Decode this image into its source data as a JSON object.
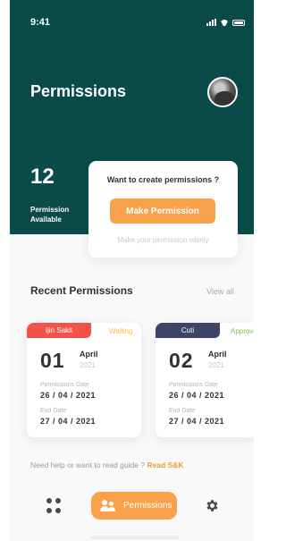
{
  "status_bar": {
    "time": "9:41"
  },
  "header": {
    "title": "Permissions",
    "available_count": "12",
    "available_label": "Permission Available"
  },
  "create_card": {
    "question": "Want to create permissions ?",
    "button_label": "Make Permission",
    "hint": "Make your permission wisely"
  },
  "recent": {
    "title": "Recent Permissions",
    "view_all": "View all",
    "cards": [
      {
        "tag": "Ijin Sakit",
        "status": "Waiting",
        "day": "01",
        "month": "April",
        "year": "2021",
        "date_label": "Permissions Date",
        "date_value": "26 / 04 / 2021",
        "end_label": "End Date",
        "end_value": "27 / 04 / 2021"
      },
      {
        "tag": "Cuti",
        "status": "Approve",
        "day": "02",
        "month": "April",
        "year": "2021",
        "date_label": "Permissions Date",
        "date_value": "26 / 04 / 2021",
        "end_label": "End Date",
        "end_value": "27 / 04 / 2021"
      }
    ]
  },
  "help": {
    "text": "Need help or want to read guide ?",
    "link": "Read S&K"
  },
  "nav": {
    "active_label": "Permissions",
    "icons": [
      "apps-icon",
      "people-icon",
      "gear-icon"
    ]
  },
  "colors": {
    "header_bg": "#0a4b4a",
    "accent": "#f8a14a",
    "sick_tag": "#f1524a",
    "leave_tag": "#3c4566",
    "waiting": "#f2c23c",
    "approve": "#7cc94b"
  }
}
